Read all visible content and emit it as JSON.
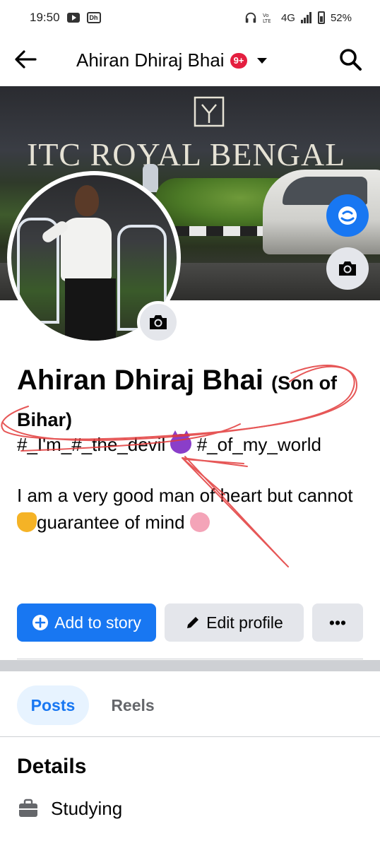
{
  "status_bar": {
    "time": "19:50",
    "network": "4G",
    "battery": "52%",
    "icons": [
      "youtube-icon",
      "app-icon",
      "headphones-icon",
      "volte-icon",
      "signal-icon",
      "battery-icon"
    ]
  },
  "header": {
    "title": "Ahiran Dhiraj Bhai",
    "badge": "9+",
    "icons": [
      "back-arrow-icon",
      "chevron-down-icon",
      "search-icon"
    ]
  },
  "cover": {
    "sign_text": "ITC ROYAL BENGAL"
  },
  "profile": {
    "name": "Ahiran Dhiraj Bhai",
    "name_suffix": "(Son of Bihar)",
    "tagline_pre": "#_I'm_#_the_devil",
    "tagline_post": "#_of_my_world",
    "bio_part1": "I am a very good man of heart but cannot",
    "bio_part2": "guarantee of mind"
  },
  "actions": {
    "add_story": "Add to story",
    "edit_profile": "Edit profile",
    "more": "•••"
  },
  "tabs": [
    {
      "label": "Posts",
      "active": true
    },
    {
      "label": "Reels",
      "active": false
    }
  ],
  "details": {
    "title": "Details",
    "items": [
      {
        "icon": "briefcase-icon",
        "label": "Studying"
      }
    ]
  },
  "colors": {
    "accent": "#1877f2",
    "button_grey": "#e4e6eb",
    "annotation": "#e23a3a",
    "badge": "#e41e3f"
  }
}
